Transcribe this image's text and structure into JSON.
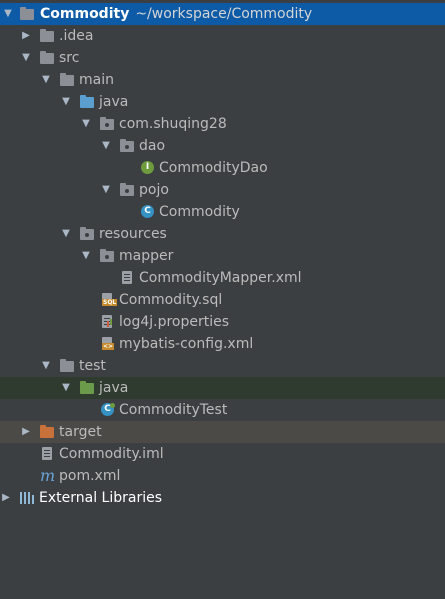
{
  "project": {
    "name": "Commodity",
    "path": "~/workspace/Commodity"
  },
  "tree": {
    "idea": ".idea",
    "src": "src",
    "main": "main",
    "main_java": "java",
    "package": "com.shuqing28",
    "dao": "dao",
    "commodity_dao": "CommodityDao",
    "pojo": "pojo",
    "commodity": "Commodity",
    "resources": "resources",
    "mapper": "mapper",
    "commodity_mapper_xml": "CommodityMapper.xml",
    "commodity_sql": "Commodity.sql",
    "log4j": "log4j.properties",
    "mybatis_config": "mybatis-config.xml",
    "test": "test",
    "test_java": "java",
    "commodity_test": "CommodityTest",
    "target": "target",
    "commodity_iml": "Commodity.iml",
    "pom": "pom.xml",
    "external_libraries": "External Libraries"
  },
  "icons": {
    "interface_letter": "I",
    "class_letter": "C",
    "sql_tag": "SQL",
    "xml_tag": "<>",
    "maven_letter": "m"
  },
  "colors": {
    "selection": "#0d5aa7",
    "test_java_row": "#303b2f",
    "target_row": "#4b4a46",
    "source_folder": "#5a9fcf",
    "test_folder": "#6a9a4a",
    "excluded_folder": "#c9713a"
  }
}
